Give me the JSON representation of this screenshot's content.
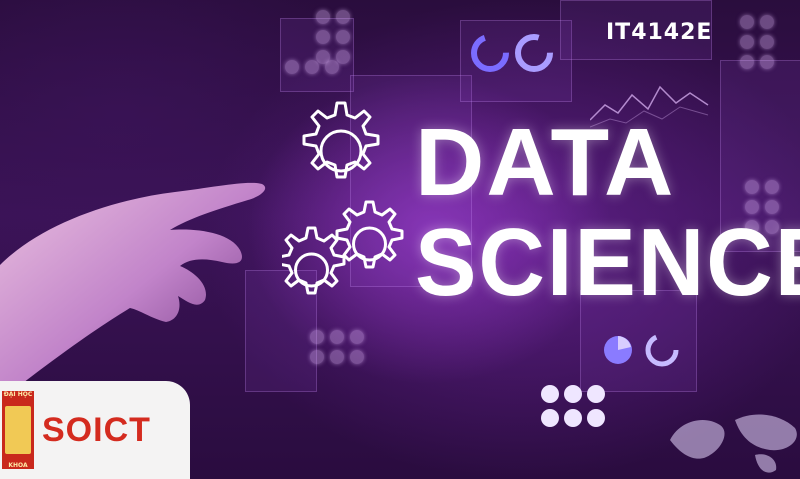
{
  "banner": {
    "course_code": "IT4142E",
    "headline_line1": "DATA",
    "headline_line2": "SCIENCE"
  },
  "logo": {
    "text": "SOICT",
    "emblem_top": "ĐẠI HỌC",
    "emblem_bottom": "KHOA",
    "colors": {
      "red": "#d42b1f",
      "gold": "#f1c955",
      "background": "#f4f3f3"
    }
  },
  "theme": {
    "accent": "#b046e6",
    "background": "#2a0d3d"
  },
  "icons": [
    "gears-icon",
    "pointing-hand-image",
    "world-map-icon",
    "data-dashboard-icons"
  ]
}
